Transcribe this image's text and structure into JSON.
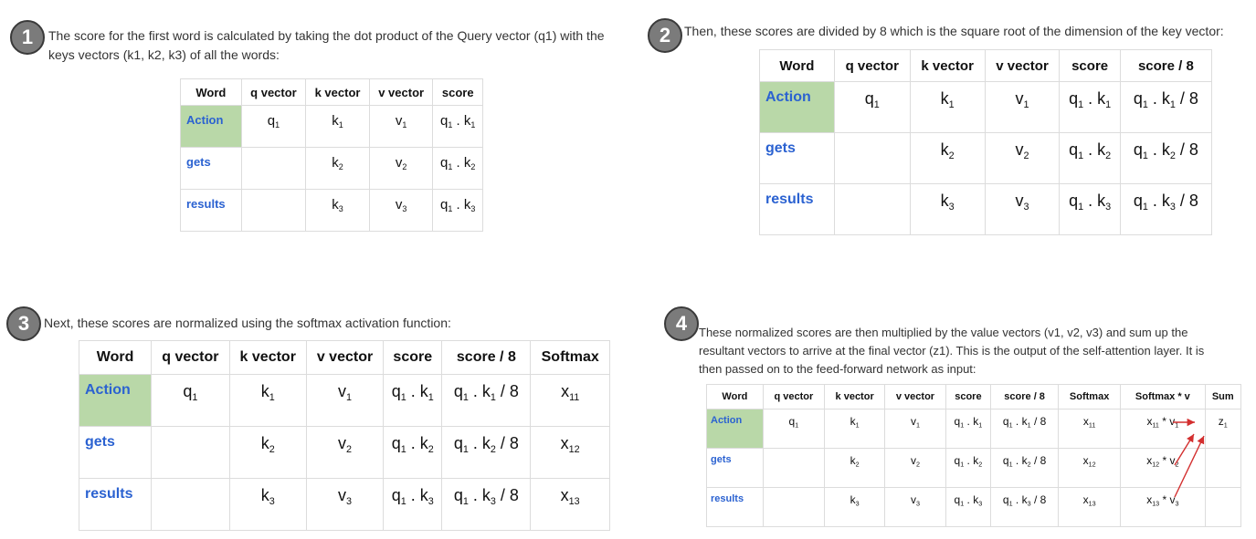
{
  "headers_full": [
    "Word",
    "q vector",
    "k vector",
    "v vector",
    "score",
    "score / 8",
    "Softmax",
    "Softmax * v",
    "Sum"
  ],
  "words": [
    "Action",
    "gets",
    "results"
  ],
  "panels": [
    {
      "number": "1",
      "text_line1": "The score for the first word is calculated by taking the dot product of the Query vector (q1) with the",
      "text_line2": "keys vectors (k1, k2, k3) of all the words:",
      "columns": 5
    },
    {
      "number": "2",
      "text_line1": "Then, these scores are divided by 8 which is the square root of the dimension of the key vector:",
      "columns": 6
    },
    {
      "number": "3",
      "text_line1": "Next, these scores are normalized using the softmax activation function:",
      "columns": 7
    },
    {
      "number": "4",
      "text_line1": "These normalized scores are then multiplied by the value vectors (v1, v2, v3) and sum up the",
      "text_line2": "resultant vectors to arrive at the final vector (z1). This is the output of the self-attention layer. It is",
      "text_line3": "then passed on to the feed-forward network as input:",
      "columns": 9
    }
  ],
  "colors": {
    "word_link": "#2b62d1",
    "first_word_bg": "#b9d8a8",
    "arrow": "#d32f2f",
    "badge": "#7b7b7b"
  }
}
